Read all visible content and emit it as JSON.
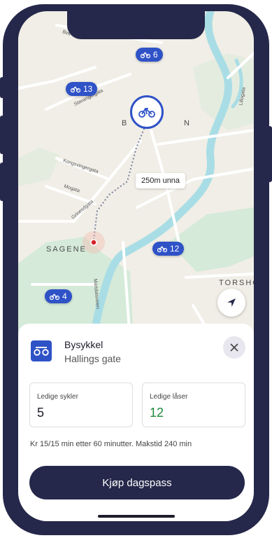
{
  "map": {
    "markers": [
      {
        "count": "6"
      },
      {
        "count": "13"
      },
      {
        "count": "12"
      },
      {
        "count": "4"
      }
    ],
    "distance_label": "250m unna",
    "places": {
      "sagene": "SAGENE",
      "torshov": "TORSHO",
      "bjolsen": "B",
      "bjolsen_end": "N"
    },
    "streets": {
      "birk": "Birk",
      "stavanger": "Stavangergata",
      "kongsvinger": "Kongsvingergata",
      "mogata": "Mogata",
      "griness": "Grinesdgata",
      "maridal": "Maridalsveien",
      "lillogata": "Lillogata"
    },
    "colors": {
      "marker": "#2f52c7",
      "water": "#a9dde5",
      "park": "#d5ead9",
      "land": "#f0eee6"
    }
  },
  "station": {
    "type": "Bysykkel",
    "name": "Hallings gate",
    "available_bikes_label": "Ledige sykler",
    "available_bikes": "5",
    "available_locks_label": "Ledige låser",
    "available_locks": "12",
    "price_info": "Kr 15/15 min etter 60 minutter. Makstid 240 min",
    "buy_button": "Kjøp dagspass"
  }
}
